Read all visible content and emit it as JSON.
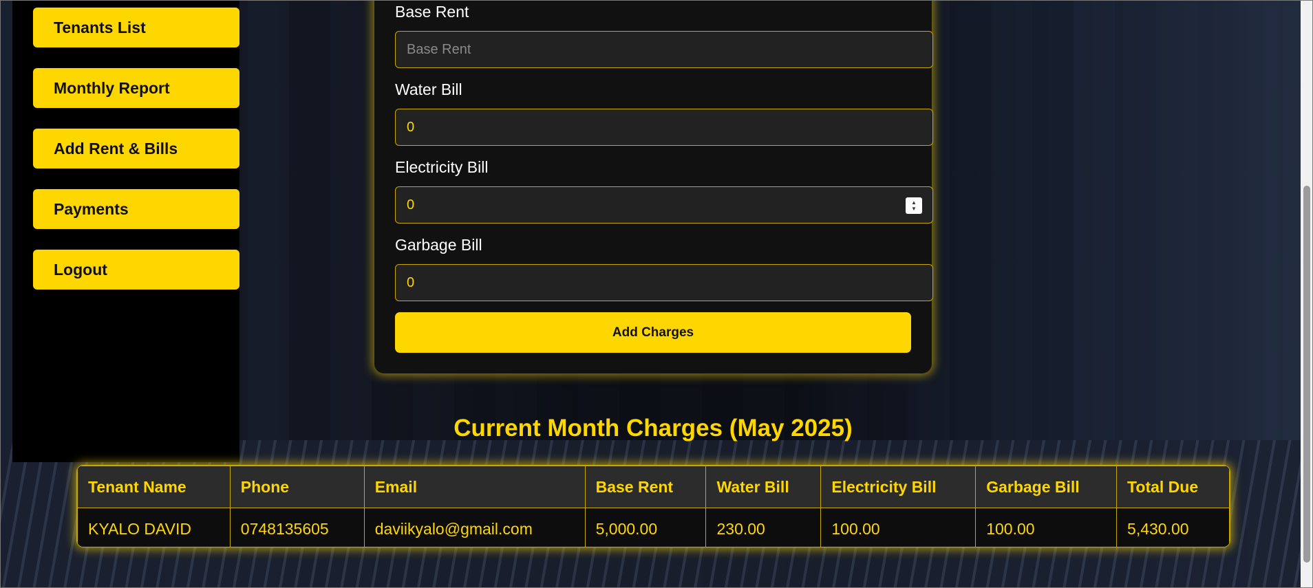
{
  "sidebar": {
    "items": [
      {
        "label": "Tenants List"
      },
      {
        "label": "Monthly Report"
      },
      {
        "label": "Add Rent & Bills"
      },
      {
        "label": "Payments"
      },
      {
        "label": "Logout"
      }
    ]
  },
  "form": {
    "base_rent": {
      "label": "Base Rent",
      "placeholder": "Base Rent",
      "value": ""
    },
    "water_bill": {
      "label": "Water Bill",
      "value": "0"
    },
    "electricity_bill": {
      "label": "Electricity Bill",
      "value": "0"
    },
    "garbage_bill": {
      "label": "Garbage Bill",
      "value": "0"
    },
    "submit_label": "Add Charges"
  },
  "charges": {
    "title": "Current Month Charges (May 2025)",
    "columns": [
      "Tenant Name",
      "Phone",
      "Email",
      "Base Rent",
      "Water Bill",
      "Electricity Bill",
      "Garbage Bill",
      "Total Due"
    ],
    "rows": [
      [
        "KYALO DAVID",
        "0748135605",
        "daviikyalo@gmail.com",
        "5,000.00",
        "230.00",
        "100.00",
        "100.00",
        "5,430.00"
      ]
    ]
  },
  "colors": {
    "accent": "#ffd700",
    "panel": "#111111",
    "sidebar": "#000000"
  }
}
